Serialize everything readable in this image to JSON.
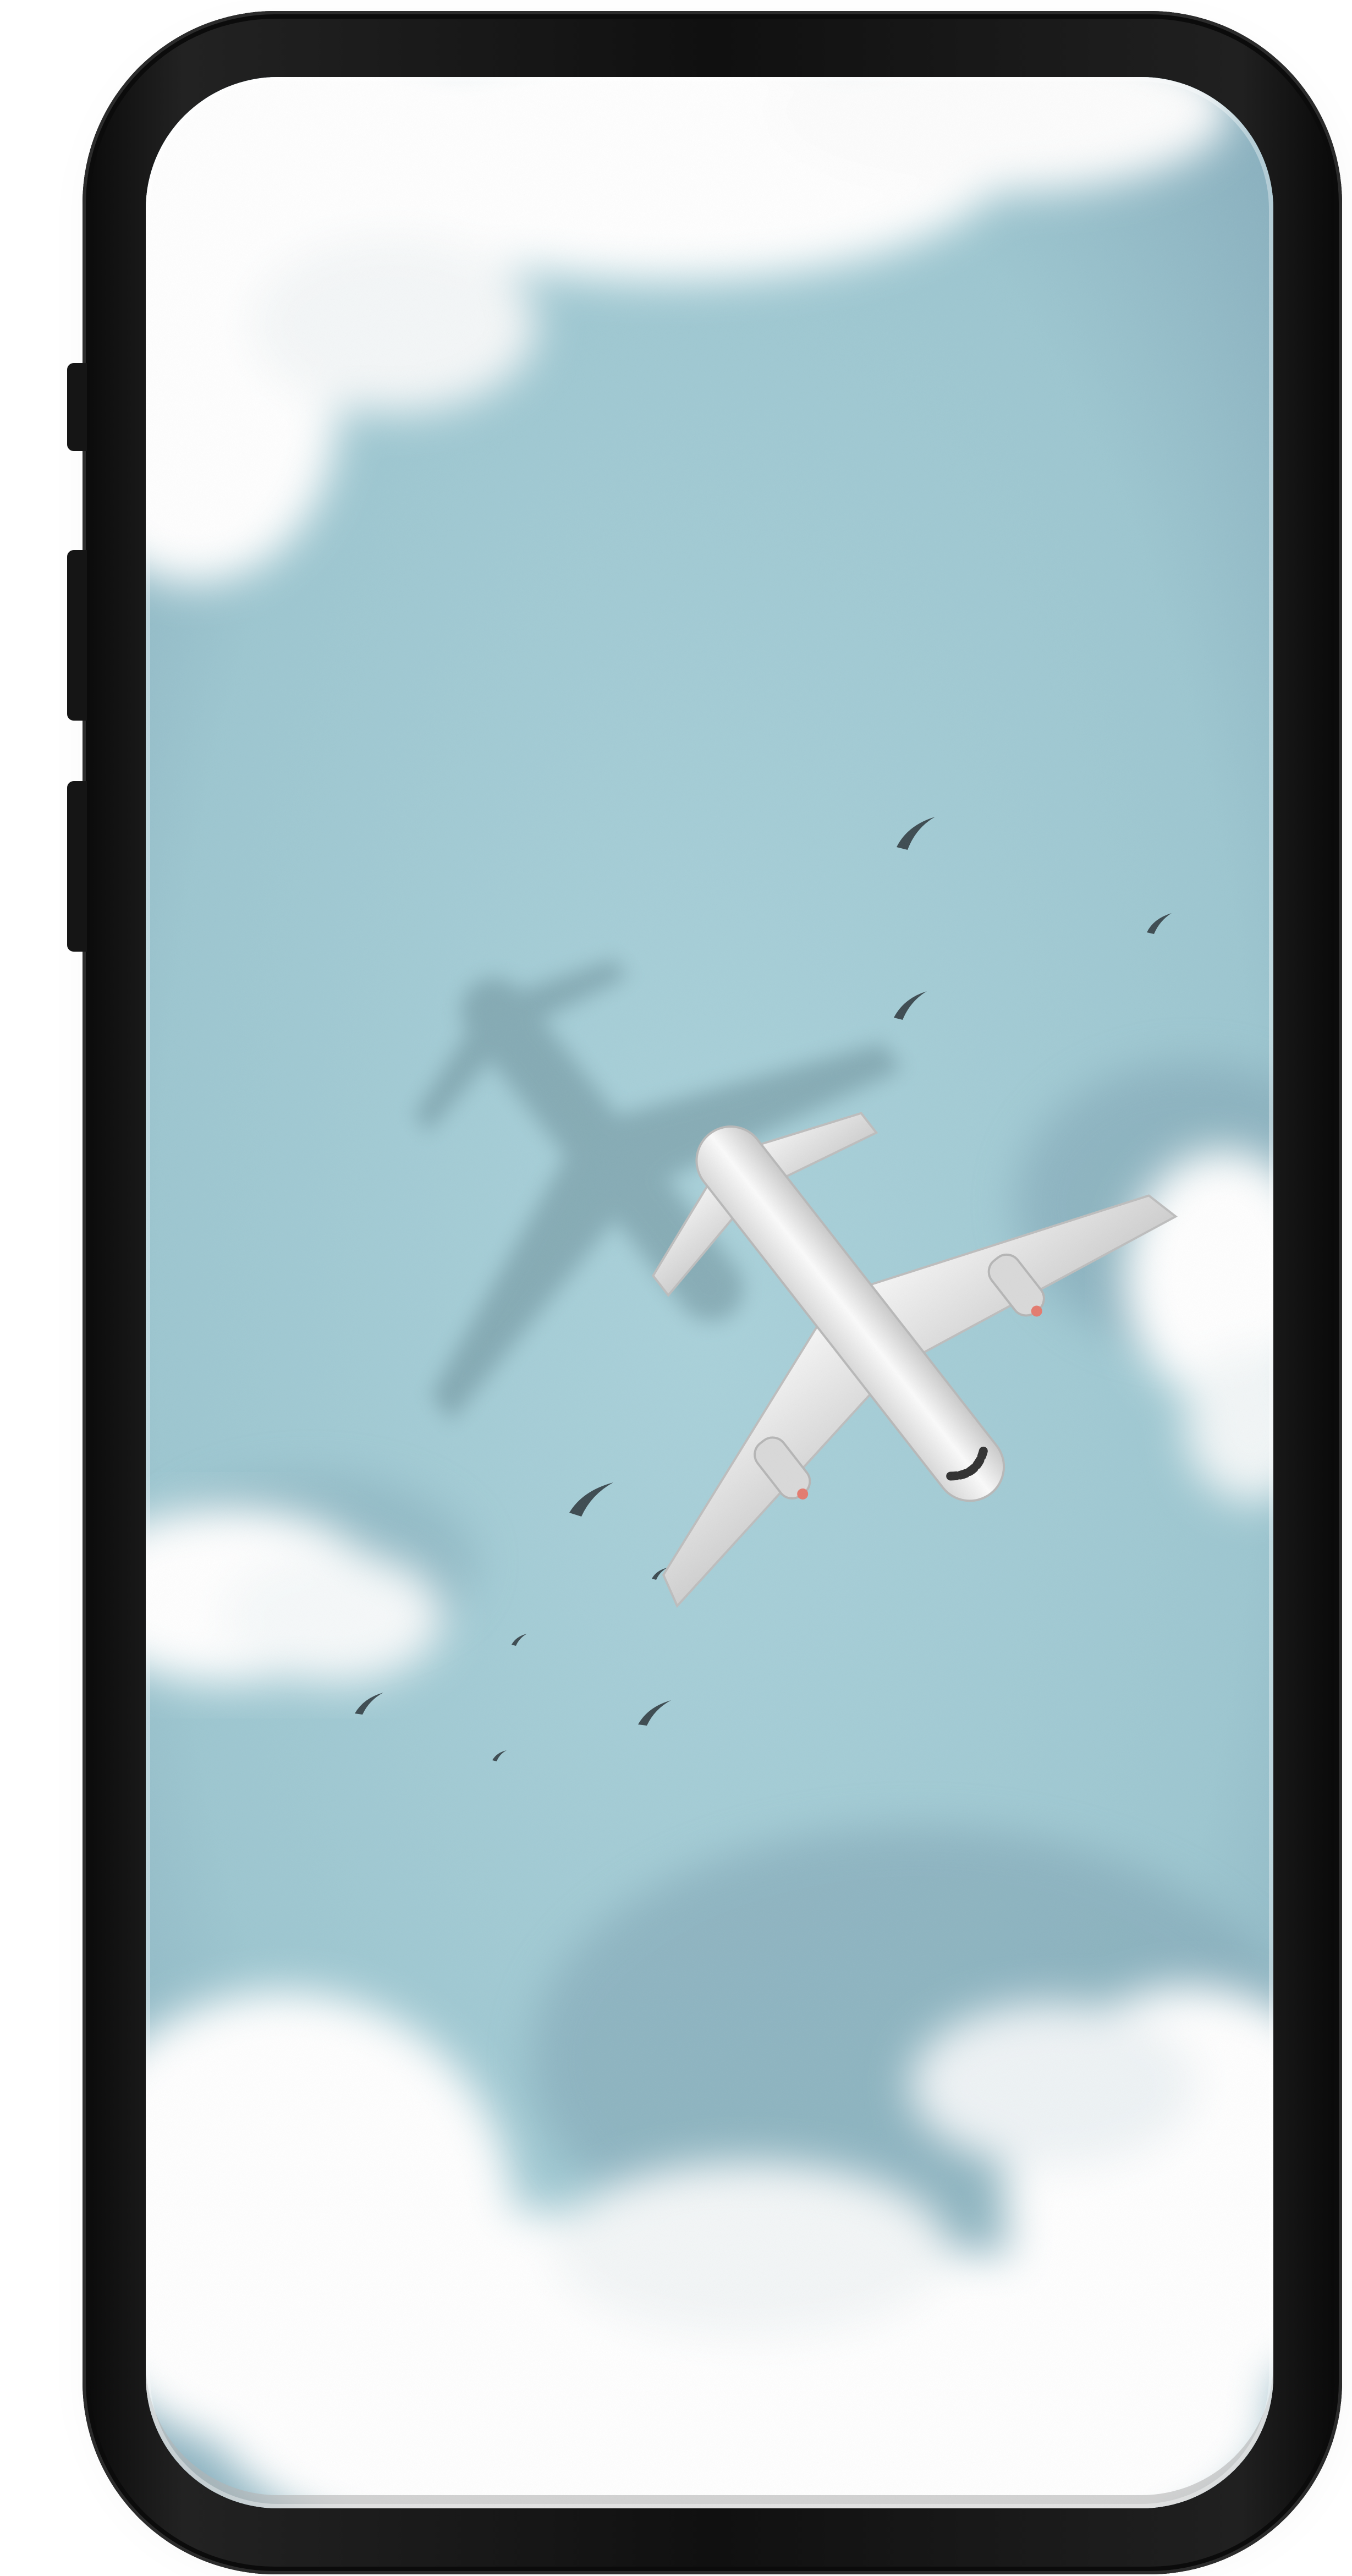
{
  "device": {
    "type": "smartphone",
    "frame_color": "#111111",
    "side_buttons": [
      "action-button",
      "volume-up-button",
      "volume-down-button"
    ]
  },
  "wallpaper": {
    "subject": "airplane-from-above",
    "sky_color": "#a5cdd6",
    "cloud_color": "#ffffff",
    "airplane_color": "#f2f2f2",
    "shadow_color": "#7d9ea6",
    "bird_color": "#3c4a50"
  }
}
